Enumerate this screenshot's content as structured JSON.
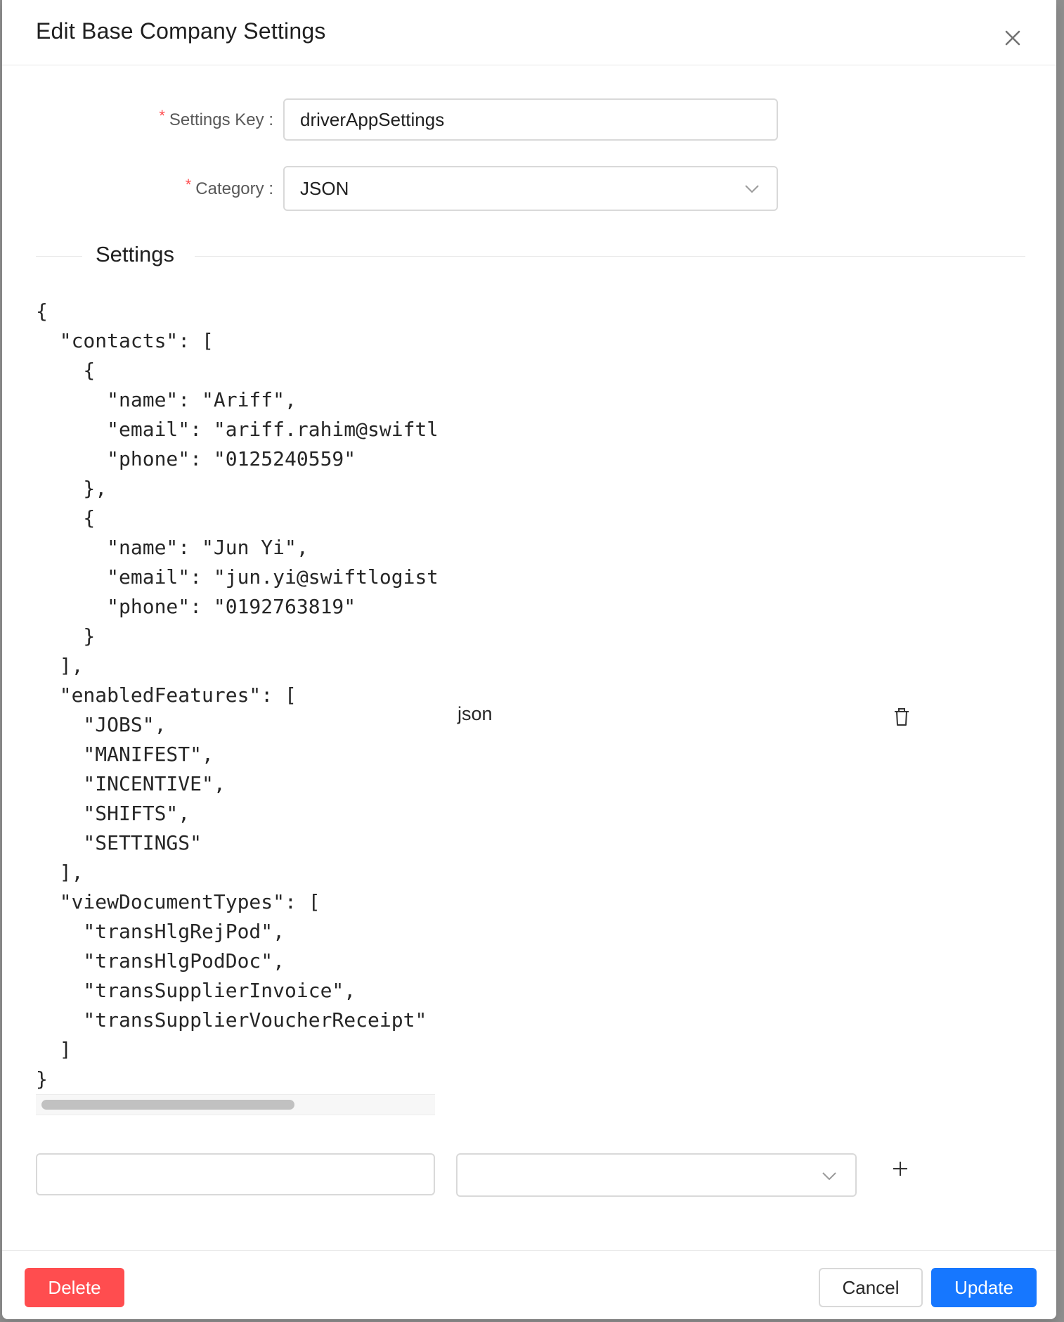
{
  "modal": {
    "title": "Edit Base Company Settings"
  },
  "form": {
    "settings_key": {
      "label": "Settings Key",
      "value": "driverAppSettings",
      "required": true
    },
    "category": {
      "label": "Category",
      "value": "JSON",
      "required": true
    }
  },
  "settings_section": {
    "title": "Settings",
    "setting_type": "json",
    "code_lines": [
      "{",
      "  \"contacts\": [",
      "    {",
      "      \"name\": \"Ariff\",",
      "      \"email\": \"ariff.rahim@swiftl",
      "      \"phone\": \"0125240559\"",
      "    },",
      "    {",
      "      \"name\": \"Jun Yi\",",
      "      \"email\": \"jun.yi@swiftlogist",
      "      \"phone\": \"0192763819\"",
      "    }",
      "  ],",
      "  \"enabledFeatures\": [",
      "    \"JOBS\",",
      "    \"MANIFEST\",",
      "    \"INCENTIVE\",",
      "    \"SHIFTS\",",
      "    \"SETTINGS\"",
      "  ],",
      "  \"viewDocumentTypes\": [",
      "    \"transHlgRejPod\",",
      "    \"transHlgPodDoc\",",
      "    \"transSupplierInvoice\",",
      "    \"transSupplierVoucherReceipt\"",
      "  ]",
      "}"
    ],
    "new_row": {
      "key_value": "",
      "type_value": ""
    }
  },
  "footer": {
    "delete_label": "Delete",
    "cancel_label": "Cancel",
    "update_label": "Update"
  },
  "colors": {
    "primary": "#1677ff",
    "danger": "#ff4d4f",
    "border": "#d9d9d9"
  },
  "icons": {
    "close": "close-icon",
    "chevron": "chevron-down-icon",
    "trash": "trash-icon",
    "plus": "plus-icon"
  }
}
